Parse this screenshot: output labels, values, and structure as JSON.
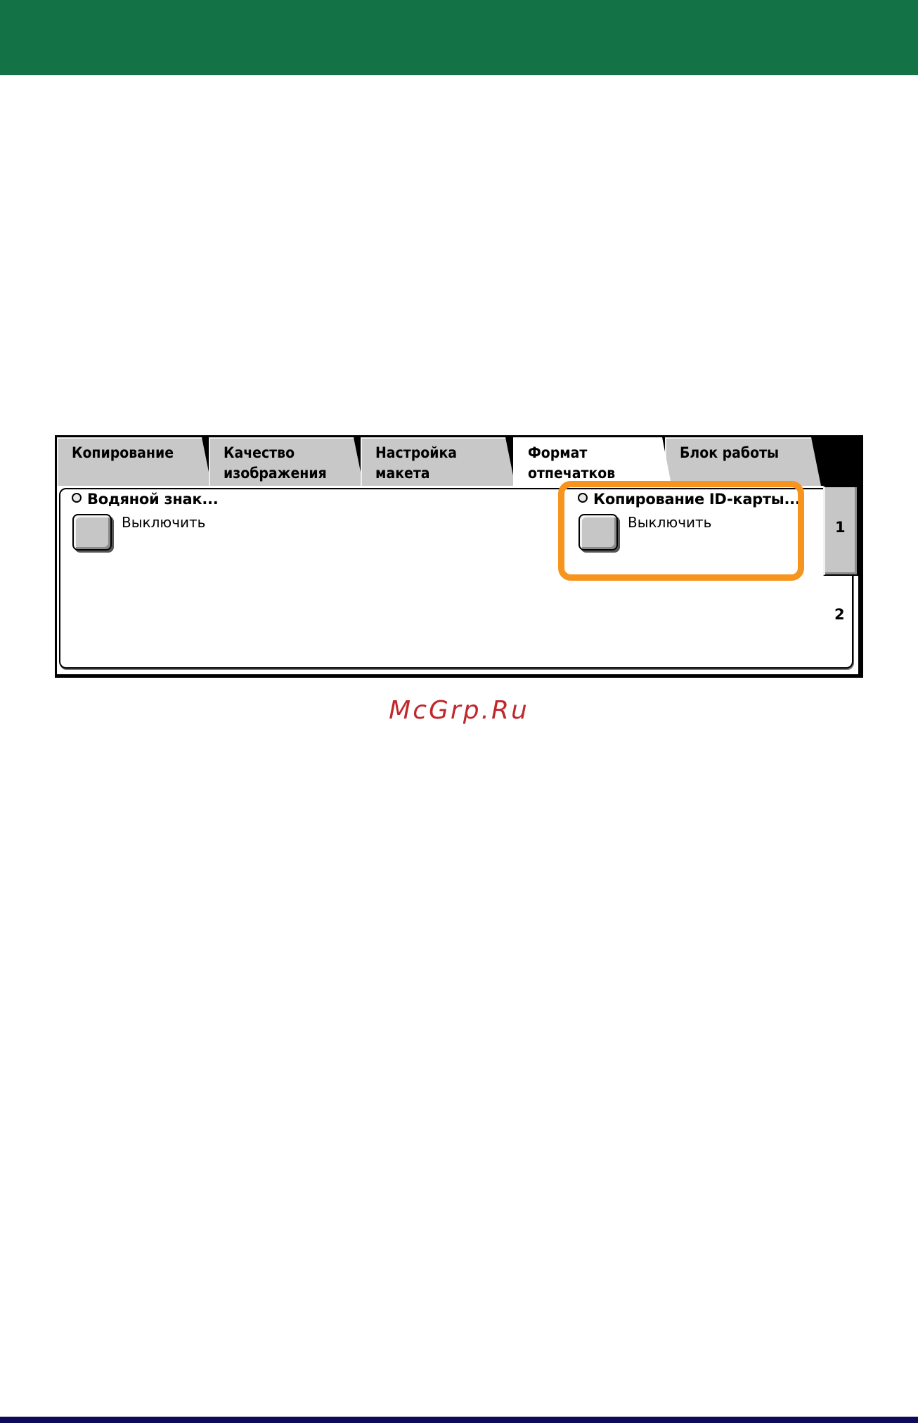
{
  "tabs": [
    {
      "label": "Копирование",
      "active": false
    },
    {
      "label": "Качество\nизображения",
      "active": false
    },
    {
      "label": "Настройка\nмакета",
      "active": false
    },
    {
      "label": "Формат\nотпечатков",
      "active": true
    },
    {
      "label": "Блок работы",
      "active": false
    }
  ],
  "features": {
    "watermark": {
      "title": "Водяной знак...",
      "value": "Выключить"
    },
    "id_card_copy": {
      "title": "Копирование ID-карты...",
      "value": "Выключить"
    }
  },
  "pages": {
    "page1": "1",
    "page2": "2"
  },
  "site_watermark": "McGrp.Ru",
  "colors": {
    "header_band": "#137246",
    "footer_band": "#0b0b5a",
    "highlight": "#f7941d",
    "site_watermark": "#c0282d"
  }
}
